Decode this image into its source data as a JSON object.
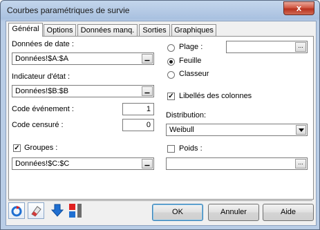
{
  "window": {
    "title": "Courbes paramétriques de survie",
    "close_symbol": "x"
  },
  "tabs": [
    {
      "label": "Général",
      "active": true
    },
    {
      "label": "Options",
      "active": false
    },
    {
      "label": "Données manq.",
      "active": false
    },
    {
      "label": "Sorties",
      "active": false
    },
    {
      "label": "Graphiques",
      "active": false
    }
  ],
  "general": {
    "dates_label": "Données de date :",
    "dates_value": "Données!$A:$A",
    "status_label": "Indicateur d'état :",
    "status_value": "Données!$B:$B",
    "event_code_label": "Code événement :",
    "event_code_value": "1",
    "censored_code_label": "Code censuré :",
    "censored_code_value": "0",
    "groups_label": "Groupes :",
    "groups_checked": true,
    "groups_value": "Données!$C:$C",
    "range_label": "Plage :",
    "range_value": "",
    "sheet_label": "Feuille",
    "workbook_label": "Classeur",
    "output_selected": "Feuille",
    "column_labels_label": "Libellés des colonnes",
    "column_labels_checked": true,
    "distribution_label": "Distribution:",
    "distribution_value": "Weibull",
    "weights_label": "Poids :",
    "weights_checked": false,
    "weights_value": "",
    "dd_button_symbol": "...",
    "dd_button_symbol_dark": "▁"
  },
  "footer": {
    "ok_label": "OK",
    "cancel_label": "Annuler",
    "help_label": "Aide"
  },
  "colors": {
    "titlebar": "#a9c1e0",
    "close_button": "#c9442f",
    "panel": "#ffffff",
    "icon_blue": "#1f6fd1",
    "icon_red": "#e02020"
  }
}
